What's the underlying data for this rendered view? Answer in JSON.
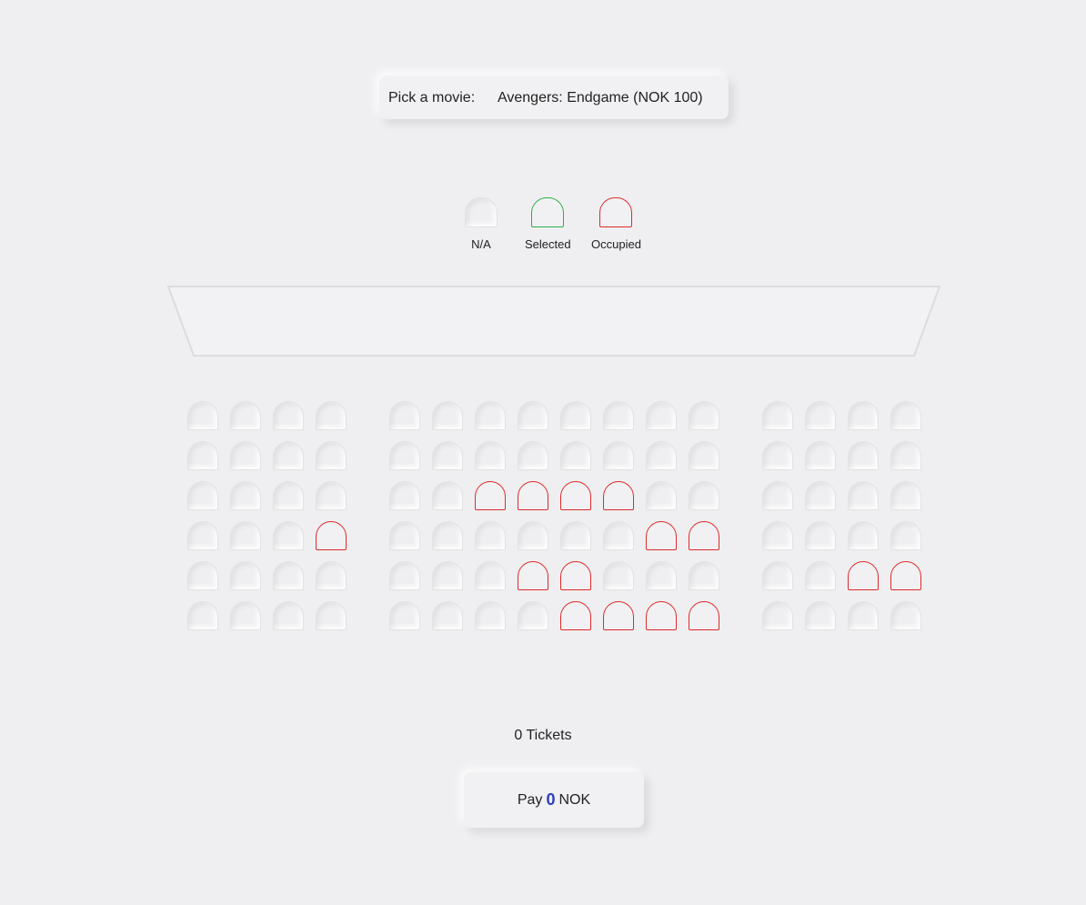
{
  "movie_picker": {
    "label": "Pick a movie:",
    "selected": "Avengers: Endgame (NOK 100)"
  },
  "legend": {
    "na": "N/A",
    "selected": "Selected",
    "occupied": "Occupied"
  },
  "seat_blocks": [
    {
      "columns": 4,
      "rows": [
        [
          0,
          0,
          0,
          0
        ],
        [
          0,
          0,
          0,
          0
        ],
        [
          0,
          0,
          0,
          0
        ],
        [
          0,
          0,
          0,
          1
        ],
        [
          0,
          0,
          0,
          0
        ],
        [
          0,
          0,
          0,
          0
        ]
      ]
    },
    {
      "columns": 8,
      "rows": [
        [
          0,
          0,
          0,
          0,
          0,
          0,
          0,
          0
        ],
        [
          0,
          0,
          0,
          0,
          0,
          0,
          0,
          0
        ],
        [
          0,
          0,
          1,
          1,
          1,
          1,
          0,
          0
        ],
        [
          0,
          0,
          0,
          0,
          0,
          0,
          1,
          1
        ],
        [
          0,
          0,
          0,
          1,
          1,
          0,
          0,
          0
        ],
        [
          0,
          0,
          0,
          0,
          1,
          1,
          1,
          1
        ]
      ]
    },
    {
      "columns": 4,
      "rows": [
        [
          0,
          0,
          0,
          0
        ],
        [
          0,
          0,
          0,
          0
        ],
        [
          0,
          0,
          0,
          0
        ],
        [
          0,
          0,
          0,
          0
        ],
        [
          0,
          0,
          1,
          1
        ],
        [
          0,
          0,
          0,
          0
        ]
      ]
    }
  ],
  "summary": {
    "ticket_count": "0",
    "tickets_label": "Tickets"
  },
  "pay": {
    "prefix": "Pay",
    "amount": "0",
    "currency": "NOK"
  },
  "colors": {
    "occupied": "#de2a2a",
    "selected": "#2ab04a",
    "amount": "#2b3fbf"
  }
}
